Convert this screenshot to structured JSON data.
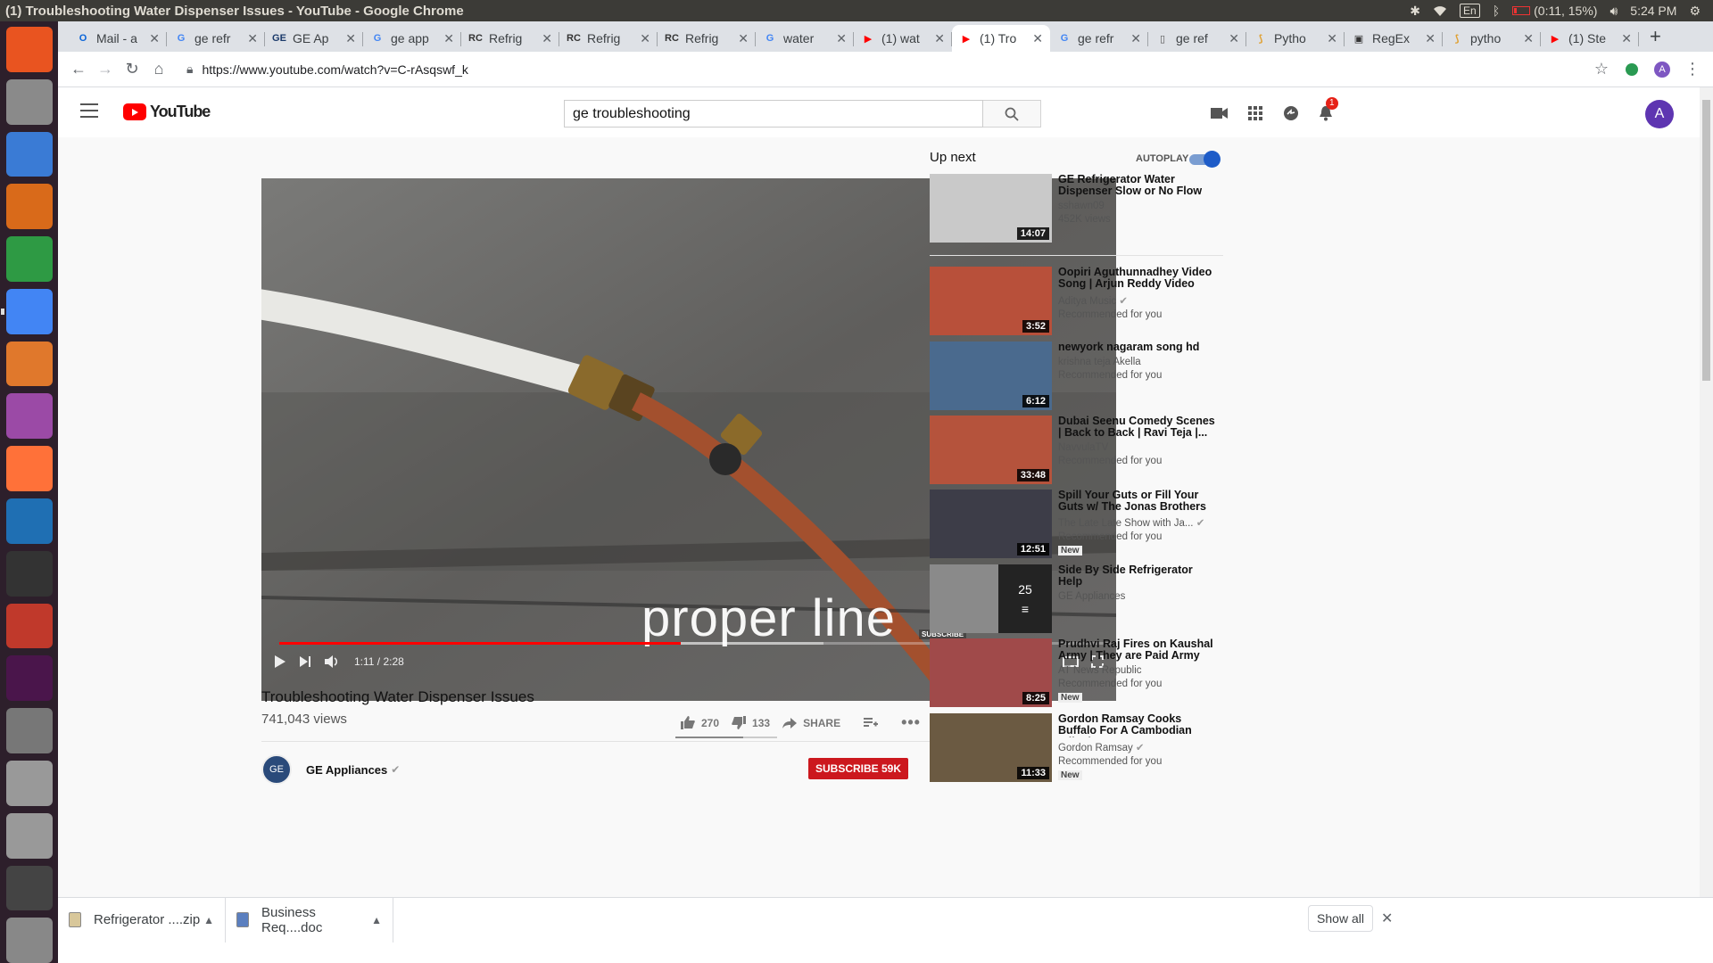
{
  "window_title": "(1) Troubleshooting Water Dispenser Issues - YouTube - Google Chrome",
  "system": {
    "lang": "En",
    "battery": "(0:11, 15%)",
    "time": "5:24 PM"
  },
  "launcher": {
    "icons": [
      "ubuntu-dash-icon",
      "files-icon",
      "writer-icon",
      "impress-icon",
      "calc-icon",
      "chrome-icon",
      "software-center-icon",
      "app-icon",
      "firefox-icon",
      "vscode-icon",
      "terminal-icon",
      "network-icon",
      "slack-icon",
      "camera-icon",
      "drive-icon",
      "drive-icon",
      "phone-icon",
      "trash-icon"
    ]
  },
  "tabs": [
    {
      "label": "Mail - a",
      "fav": "O",
      "color": "#0a64d8"
    },
    {
      "label": "ge refr",
      "fav": "G",
      "color": "#4285f4"
    },
    {
      "label": "GE Ap",
      "fav": "GE",
      "color": "#1b3a6b"
    },
    {
      "label": "ge app",
      "fav": "G",
      "color": "#4285f4"
    },
    {
      "label": "Refrig",
      "fav": "RC",
      "color": "#333"
    },
    {
      "label": "Refrig",
      "fav": "RC",
      "color": "#333"
    },
    {
      "label": "Refrig",
      "fav": "RC",
      "color": "#333"
    },
    {
      "label": "water",
      "fav": "G",
      "color": "#4285f4"
    },
    {
      "label": "(1) wat",
      "fav": "▶",
      "color": "#f00"
    },
    {
      "label": "(1) Tro",
      "fav": "▶",
      "color": "#f00",
      "active": true
    },
    {
      "label": "ge refr",
      "fav": "G",
      "color": "#4285f4"
    },
    {
      "label": "ge ref",
      "fav": "▯",
      "color": "#555"
    },
    {
      "label": "Pytho",
      "fav": "⟆",
      "color": "#e0a030"
    },
    {
      "label": "RegEx",
      "fav": "▣",
      "color": "#333"
    },
    {
      "label": "pytho",
      "fav": "⟆",
      "color": "#e0a030"
    },
    {
      "label": "(1) Ste",
      "fav": "▶",
      "color": "#f00"
    }
  ],
  "url": "https://www.youtube.com/watch?v=C-rAsqswf_k",
  "profile_initial": "A",
  "search": {
    "query": "ge troubleshooting"
  },
  "notifications": "1",
  "player": {
    "caption": "proper line",
    "watermark": "SUBSCRIBE",
    "time": "1:11 / 2:28",
    "progress": 0.483,
    "buffered": 0.655
  },
  "video": {
    "title": "Troubleshooting Water Dispenser Issues",
    "views": "741,043 views",
    "likes": "270",
    "dislikes": "133",
    "like_ratio": 0.67,
    "share": "SHARE",
    "channel": "GE Appliances",
    "subscribe": "SUBSCRIBE 59K"
  },
  "upnext": {
    "heading": "Up next",
    "autoplay": "AUTOPLAY",
    "items": [
      {
        "title": "GE Refrigerator Water Dispenser Slow or No Flow",
        "channel": "sshawn09",
        "meta": "452K views",
        "duration": "14:07",
        "thumb": "#c9c9c9",
        "verified": false,
        "new": false
      },
      {
        "title": "Oopiri Aguthunnadhey Video Song | Arjun Reddy Video Son...",
        "channel": "Aditya Music",
        "meta": "Recommended for you",
        "duration": "3:52",
        "thumb": "#b8503a",
        "verified": true,
        "new": false
      },
      {
        "title": "newyork nagaram song hd",
        "channel": "krishna teja Akella",
        "meta": "Recommended for you",
        "duration": "6:12",
        "thumb": "#4a6a8e",
        "verified": false,
        "new": false
      },
      {
        "title": "Dubai Seenu Comedy Scenes | Back to Back | Ravi Teja |...",
        "channel": "NavvulaTV",
        "meta": "Recommended for you",
        "duration": "33:48",
        "thumb": "#b5533c",
        "verified": false,
        "new": false
      },
      {
        "title": "Spill Your Guts or Fill Your Guts w/ The Jonas Brothers",
        "channel": "The Late Late Show with Ja...",
        "meta": "Recommended for you",
        "duration": "12:51",
        "thumb": "#3d3d48",
        "verified": true,
        "new": true,
        "new_label": "New"
      },
      {
        "title": "Side By Side Refrigerator Help",
        "channel": "GE Appliances",
        "meta": "",
        "duration": "",
        "thumb": "#8a8a8a",
        "verified": false,
        "new": false,
        "playlist_count": "25"
      },
      {
        "title": "Prudhvi Raj Fires on Kaushal Army | They are Paid Army",
        "channel": "AT News Republic",
        "meta": "Recommended for you",
        "duration": "8:25",
        "thumb": "#a04a4a",
        "verified": false,
        "new": true,
        "new_label": "New"
      },
      {
        "title": "Gordon Ramsay Cooks Buffalo For A Cambodian Tribe |...",
        "channel": "Gordon Ramsay",
        "meta": "Recommended for you",
        "duration": "11:33",
        "thumb": "#6b5a42",
        "verified": true,
        "new": true,
        "new_label": "New"
      }
    ]
  },
  "downloads": [
    {
      "name": "Refrigerator ....zip"
    },
    {
      "name": "Business Req....doc"
    }
  ],
  "show_all": "Show all"
}
